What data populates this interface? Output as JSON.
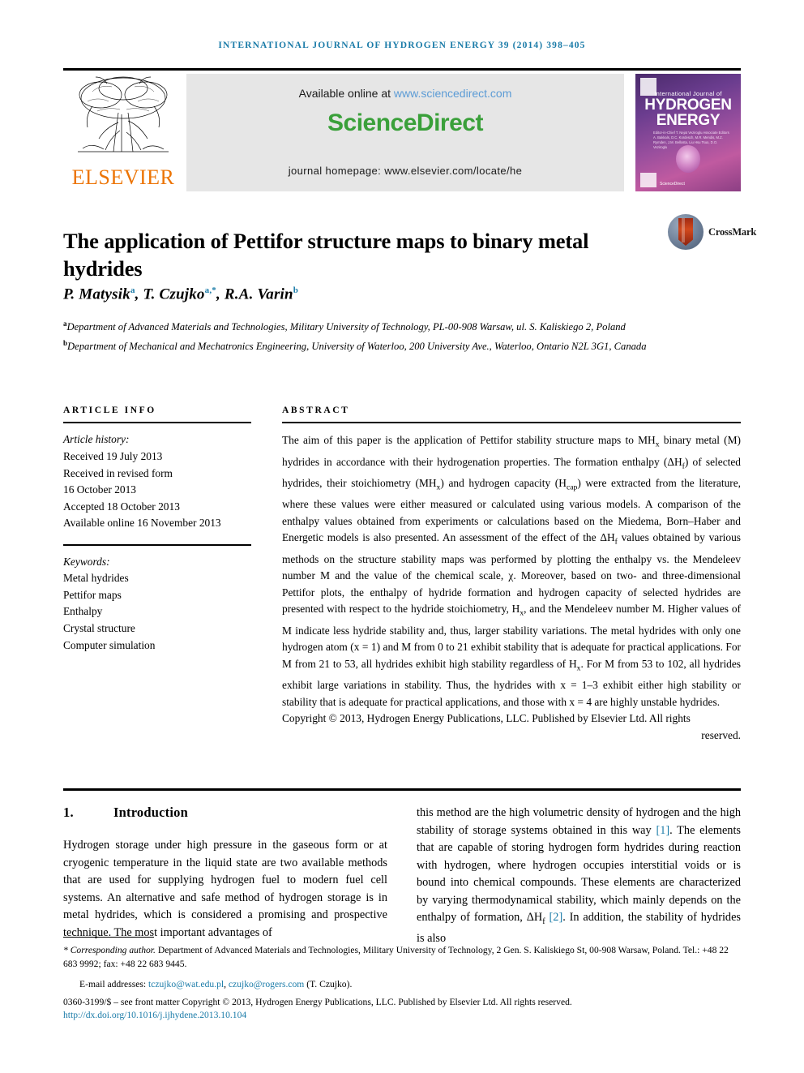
{
  "running_head": "International Journal of Hydrogen Energy 39 (2014) 398–405",
  "masthead": {
    "publisher": "ELSEVIER",
    "available_prefix": "Available online at ",
    "available_url": "www.sciencedirect.com",
    "sciencedirect_logo": "ScienceDirect",
    "journal_homepage": "journal homepage: www.elsevier.com/locate/he",
    "cover": {
      "line1": "International Journal of",
      "line2": "HYDROGEN",
      "line3": "ENERGY",
      "editors": "Editor-in-Chief  T. Nejat Veziroglu   Associate Editors  A. Bakkals, D.C. Kordesch, M.R. Mendis, M.Z. Rymden, J.M. Bellosta, Liu Hsu Tsuo, D.O. Veziroglu",
      "science_direct": "ScienceDirect"
    }
  },
  "article": {
    "title": "The application of Pettifor structure maps to binary metal hydrides",
    "crossmark_label": "CrossMark",
    "authors_html": "P. Matysik<sup>a</sup>, T. Czujko<sup>a,*</sup>, R.A. Varin<sup>b</sup>",
    "affiliation_a": "Department of Advanced Materials and Technologies, Military University of Technology, PL-00-908 Warsaw, ul. S. Kaliskiego 2, Poland",
    "affiliation_b": "Department of Mechanical and Mechatronics Engineering, University of Waterloo, 200 University Ave., Waterloo, Ontario N2L 3G1, Canada"
  },
  "article_info": {
    "heading": "Article info",
    "history_label": "Article history:",
    "history": [
      "Received 19 July 2013",
      "Received in revised form",
      "16 October 2013",
      "Accepted 18 October 2013",
      "Available online 16 November 2013"
    ],
    "keywords_label": "Keywords:",
    "keywords": [
      "Metal hydrides",
      "Pettifor maps",
      "Enthalpy",
      "Crystal structure",
      "Computer simulation"
    ]
  },
  "abstract": {
    "heading": "Abstract",
    "body_html": "The aim of this paper is the application of Pettifor stability structure maps to MH<sub>x</sub> binary metal (M) hydrides in accordance with their hydrogenation properties. The formation enthalpy (ΔH<sub>f</sub>) of selected hydrides, their stoichiometry (MH<sub>x</sub>) and hydrogen capacity (H<sub>cap</sub>) were extracted from the literature, where these values were either measured or calculated using various models. A comparison of the enthalpy values obtained from experiments or calculations based on the Miedema, Born–Haber and Energetic models is also presented. An assessment of the effect of the ΔH<sub>f</sub> values obtained by various methods on the structure stability maps was performed by plotting the enthalpy vs. the Mendeleev number M and the value of the chemical scale, χ. Moreover, based on two- and three-dimensional Pettifor plots, the enthalpy of hydride formation and hydrogen capacity of selected hydrides are presented with respect to the hydride stoichiometry, H<sub>x</sub>, and the Mendeleev number M. Higher values of M indicate less hydride stability and, thus, larger stability variations. The metal hydrides with only one hydrogen atom (x = 1) and M from 0 to 21 exhibit stability that is adequate for practical applications. For M from 21 to 53, all hydrides exhibit high stability regardless of H<sub>x</sub>. For M from 53 to 102, all hydrides exhibit large variations in stability. Thus, the hydrides with x = 1–3 exhibit either high stability or stability that is adequate for practical applications, and those with x = 4 are highly unstable hydrides.",
    "copyright": "Copyright © 2013, Hydrogen Energy Publications, LLC. Published by Elsevier Ltd. All rights",
    "reserved": "reserved."
  },
  "introduction": {
    "number": "1.",
    "heading": "Introduction",
    "left_html": "Hydrogen storage under high pressure in the gaseous form or at cryogenic temperature in the liquid state are two available methods that are used for supplying hydrogen fuel to modern fuel cell systems. An alternative and safe method of hydrogen storage is in metal hydrides, which is considered a promising and prospective technique. The most important advantages of",
    "right_html": "this method are the high volumetric density of hydrogen and the high stability of storage systems obtained in this way <span class=\"ref\">[1]</span>. The elements that are capable of storing hydrogen form hydrides during reaction with hydrogen, where hydrogen occupies interstitial voids or is bound into chemical compounds. These elements are characterized by varying thermodynamical stability, which mainly depends on the enthalpy of formation, ΔH<sub>f</sub> <span class=\"ref\">[2]</span>. In addition, the stability of hydrides is also"
  },
  "footnotes": {
    "corresponding_html": "<span class=\"it\">* Corresponding author.</span> Department of Advanced Materials and Technologies, Military University of Technology, 2 Gen. S. Kaliskiego St, 00-908 Warsaw, Poland. Tel.: +48 22 683 9992; fax: +48 22 683 9445.",
    "email_html": "E-mail addresses: <span class=\"link\">tczujko@wat.edu.pl</span>, <span class=\"link\">czujko@rogers.com</span> (T. Czujko).",
    "issn_line": "0360-3199/$ – see front matter Copyright © 2013, Hydrogen Energy Publications, LLC. Published by Elsevier Ltd. All rights reserved.",
    "doi": "http://dx.doi.org/10.1016/j.ijhydene.2013.10.104"
  }
}
